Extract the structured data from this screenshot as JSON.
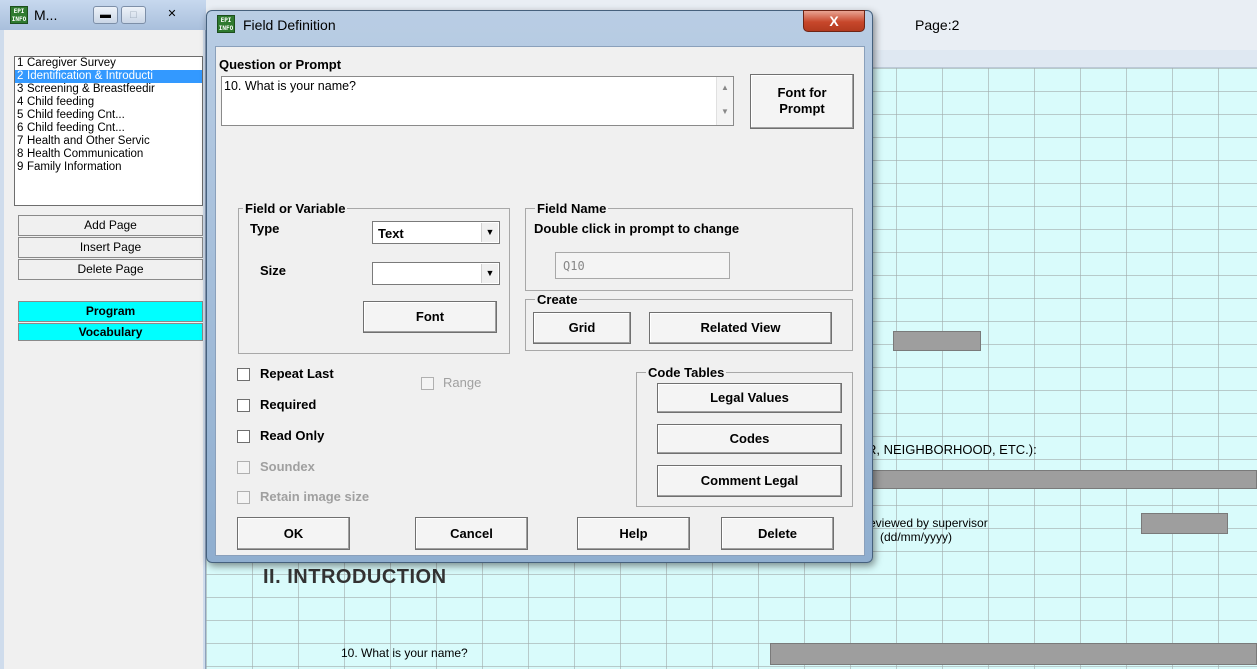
{
  "page_list_window": {
    "title": "M...",
    "pages": [
      {
        "num": "1",
        "label": "Caregiver Survey"
      },
      {
        "num": "2",
        "label": "Identification & Introducti"
      },
      {
        "num": "3",
        "label": "Screening & Breastfeedir"
      },
      {
        "num": "4",
        "label": "Child feeding"
      },
      {
        "num": "5",
        "label": "Child feeding Cnt..."
      },
      {
        "num": "6",
        "label": "Child feeding Cnt..."
      },
      {
        "num": "7",
        "label": "Health and Other Servic"
      },
      {
        "num": "8",
        "label": "Health Communication"
      },
      {
        "num": "9",
        "label": "Family Information"
      }
    ],
    "selected_index": 1,
    "buttons": {
      "add_page": "Add Page",
      "insert_page": "Insert Page",
      "delete_page": "Delete Page",
      "program": "Program",
      "vocabulary": "Vocabulary"
    }
  },
  "canvas": {
    "page_label": "Page:2",
    "neighborhood_text": "R, NEIGHBORHOOD, ETC.):",
    "reviewed_line1": "eviewed by supervisor",
    "reviewed_line2": "(dd/mm/yyyy)",
    "section_heading": "II. INTRODUCTION",
    "question_text": "10. What is your name?"
  },
  "dialog": {
    "title": "Field Definition",
    "close_glyph": "X",
    "question_label": "Question or Prompt",
    "prompt_text": "10. What is your name?",
    "font_for_prompt_button": "Font for Prompt",
    "field_group": {
      "title": "Field or Variable",
      "type_label": "Type",
      "type_value": "Text",
      "size_label": "Size",
      "size_value": "",
      "font_button": "Font"
    },
    "field_name_group": {
      "title": "Field Name",
      "hint": "Double click in prompt to change",
      "value": "Q10"
    },
    "create_group": {
      "title": "Create",
      "grid_button": "Grid",
      "related_view_button": "Related View"
    },
    "checkboxes": {
      "repeat_last": "Repeat Last",
      "range": "Range",
      "required": "Required",
      "read_only": "Read Only",
      "soundex": "Soundex",
      "retain_image_size": "Retain image size"
    },
    "code_tables": {
      "title": "Code Tables",
      "legal_values": "Legal Values",
      "codes": "Codes",
      "comment_legal": "Comment Legal"
    },
    "footer": {
      "ok": "OK",
      "cancel": "Cancel",
      "help": "Help",
      "delete": "Delete"
    }
  }
}
